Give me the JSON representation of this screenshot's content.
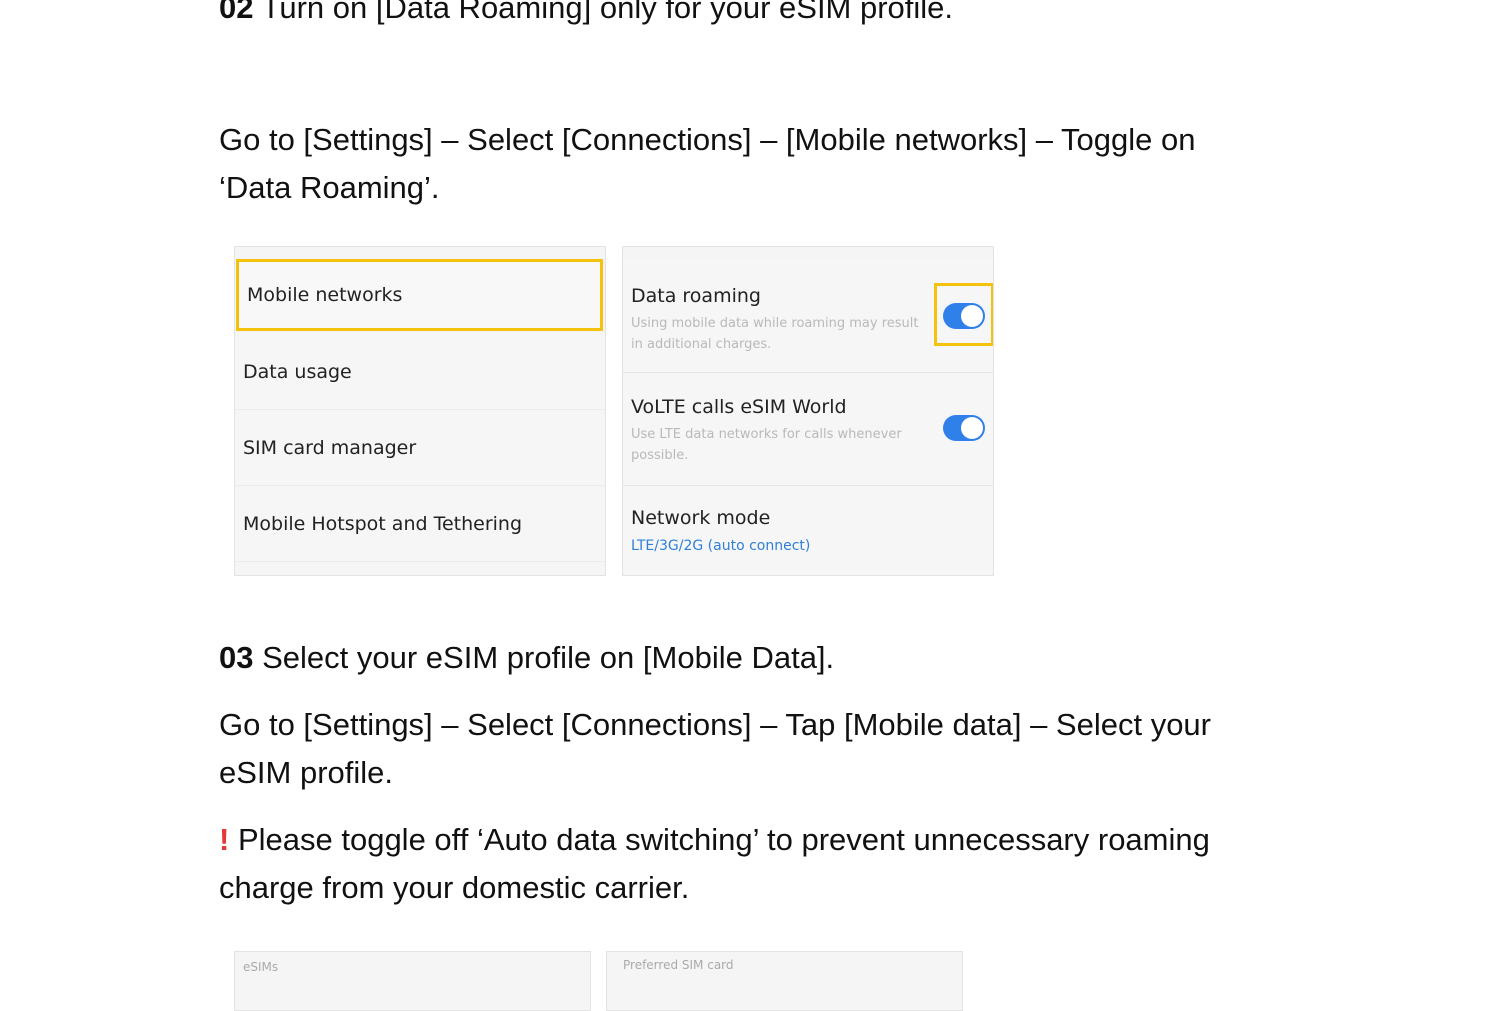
{
  "step02": {
    "number": "02",
    "text": "Turn on [Data Roaming] only for your eSIM profile."
  },
  "step02_instruction": {
    "line1": "Go to [Settings] – Select [Connections] – [Mobile networks] – Toggle on",
    "line2": "‘Data Roaming’."
  },
  "screenshot_left": {
    "items": [
      {
        "label": "Mobile networks",
        "highlighted": true
      },
      {
        "label": "Data usage"
      },
      {
        "label": "SIM card manager"
      },
      {
        "label": "Mobile Hotspot and Tethering"
      }
    ],
    "highlight_color": "#f4c20d"
  },
  "screenshot_right": {
    "data_roaming": {
      "title": "Data roaming",
      "desc": "Using mobile data while roaming may result in additional charges.",
      "toggle_on": true
    },
    "volte": {
      "title": "VoLTE calls eSIM World",
      "desc": "Use LTE data networks for calls whenever possible.",
      "toggle_on": true
    },
    "network_mode": {
      "title": "Network mode",
      "value": "LTE/3G/2G (auto connect)"
    },
    "toggle_color": "#2f80e8"
  },
  "step03": {
    "number": "03",
    "text": "Select your eSIM profile on [Mobile Data]."
  },
  "step03_instruction": {
    "line1": "Go to [Settings] – Select [Connections] – Tap [Mobile data] – Select your",
    "line2": "eSIM profile."
  },
  "warning": {
    "mark": "!",
    "line1": "Please toggle off ‘Auto data switching’ to prevent unnecessary roaming",
    "line2": "charge from your domestic carrier.",
    "mark_color": "#e53935"
  },
  "screenshot_bottom": {
    "left_label": "eSIMs",
    "right_label": "Preferred SIM card"
  }
}
